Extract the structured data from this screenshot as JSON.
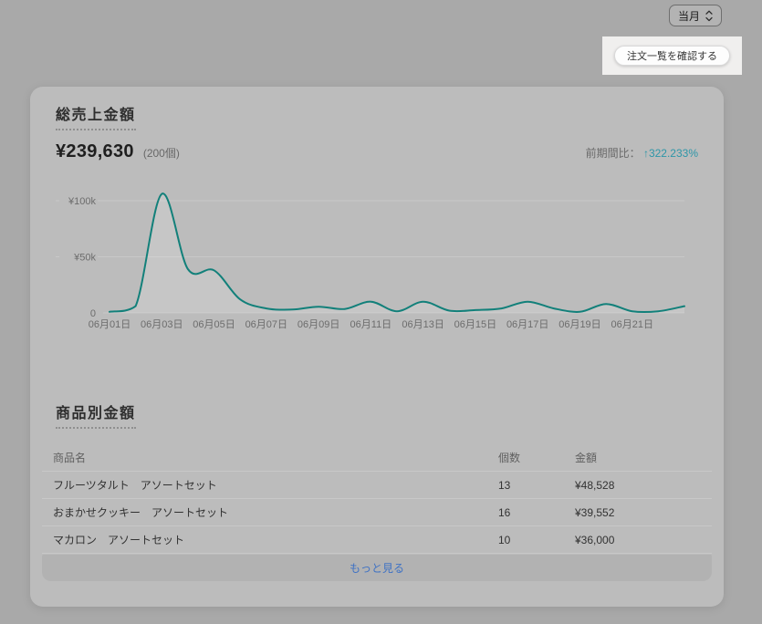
{
  "colors": {
    "backdrop": "#a9a9a9",
    "card": "#bcbcbc",
    "chart_line": "#12807a",
    "chart_grid": "#c8c8c8",
    "axis_text": "#6c6c6c",
    "comparison_accent": "#2d96a8",
    "link": "#3f72c4"
  },
  "icons": {
    "period_select": "updown-chevron-icon"
  },
  "period_select": {
    "value": "当月"
  },
  "highlight": {
    "button_label": "注文一覧を確認する"
  },
  "sales_card": {
    "title": "総売上金額",
    "total_amount": "¥239,630",
    "total_count": "(200個)",
    "comparison_label": "前期間比：",
    "comparison_value": "↑322.233%"
  },
  "chart_data": {
    "type": "line",
    "title": "総売上金額",
    "x": [
      "06月01日",
      "06月02日",
      "06月03日",
      "06月04日",
      "06月05日",
      "06月06日",
      "06月07日",
      "06月08日",
      "06月09日",
      "06月10日",
      "06月11日",
      "06月12日",
      "06月13日",
      "06月14日",
      "06月15日",
      "06月16日",
      "06月17日",
      "06月18日",
      "06月19日",
      "06月20日",
      "06月21日",
      "06月22日",
      "06月23日"
    ],
    "values": [
      1000,
      6000,
      106000,
      39000,
      38000,
      12000,
      4000,
      3000,
      5500,
      3500,
      10000,
      1500,
      10000,
      2000,
      2500,
      4000,
      10000,
      4000,
      1000,
      8000,
      1500,
      1500,
      6000
    ],
    "x_tick_labels": [
      "06月01日",
      "06月03日",
      "06月05日",
      "06月07日",
      "06月09日",
      "06月11日",
      "06月13日",
      "06月15日",
      "06月17日",
      "06月19日",
      "06月21日"
    ],
    "y_ticks": [
      {
        "label": "¥100k",
        "value": 100000
      },
      {
        "label": "¥50k",
        "value": 50000
      },
      {
        "label": "0",
        "value": 0
      }
    ],
    "ylim": [
      0,
      110000
    ],
    "grid": "horizontal",
    "legend": "none"
  },
  "product_table": {
    "title": "商品別金額",
    "columns": [
      "商品名",
      "個数",
      "金額"
    ],
    "rows": [
      {
        "name": "フルーツタルト　アソートセット",
        "count": "13",
        "amount": "¥48,528"
      },
      {
        "name": "おまかせクッキー　アソートセット",
        "count": "16",
        "amount": "¥39,552"
      },
      {
        "name": "マカロン　アソートセット",
        "count": "10",
        "amount": "¥36,000"
      }
    ],
    "more_label": "もっと見る"
  }
}
